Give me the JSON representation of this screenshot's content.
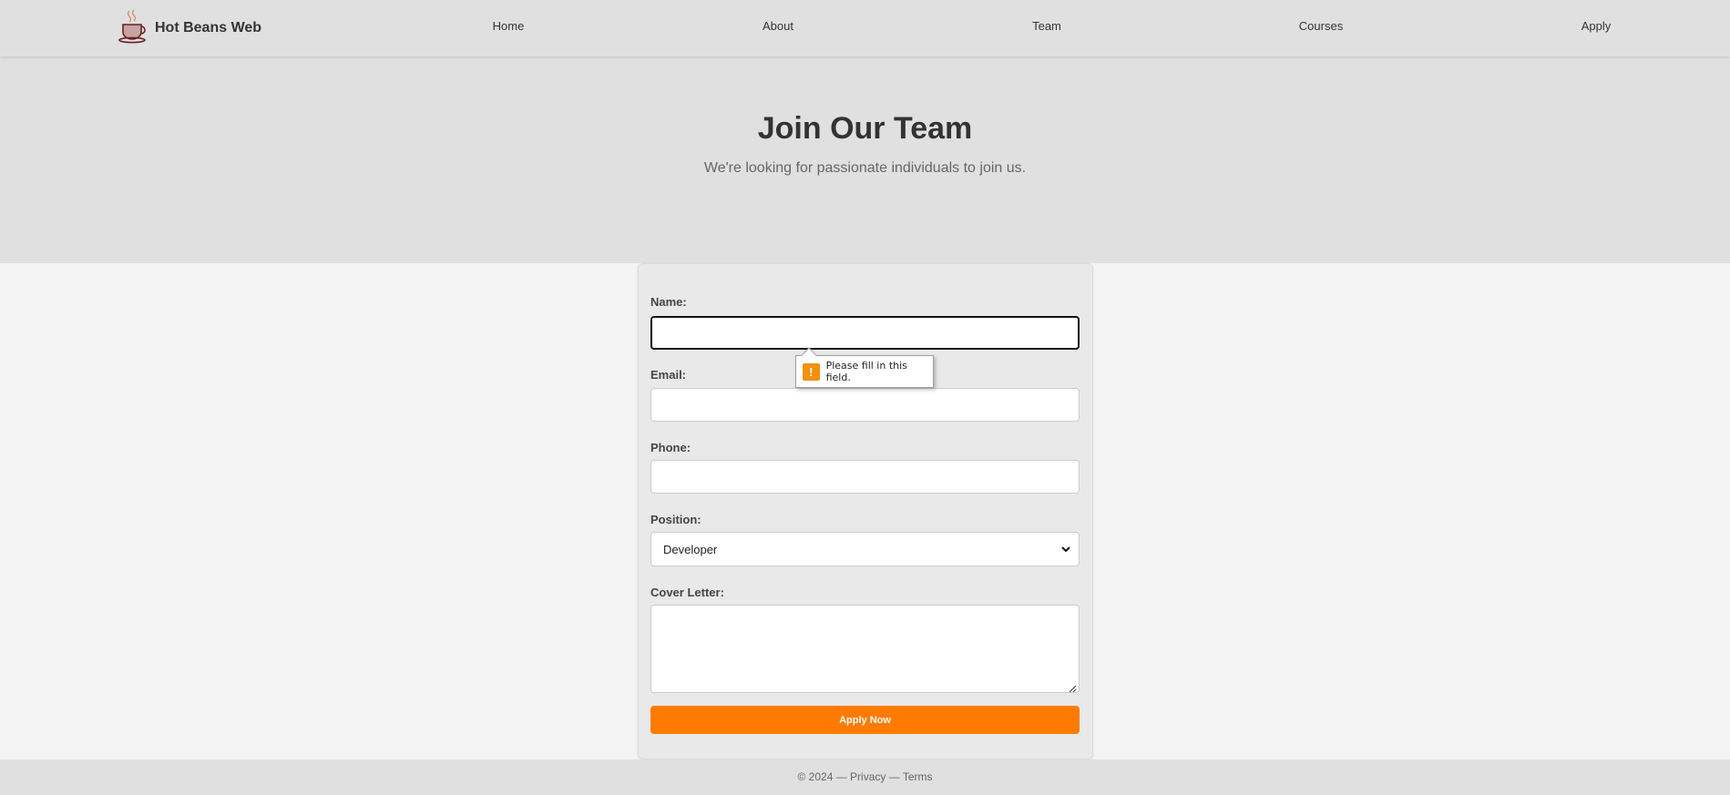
{
  "brand": {
    "name": "Hot Beans Web",
    "logo_icon": "coffee-cup-icon"
  },
  "nav": {
    "items": [
      "Home",
      "About",
      "Team",
      "Courses",
      "Apply"
    ]
  },
  "hero": {
    "title": "Join Our Team",
    "subtitle": "We're looking for passionate individuals to join us."
  },
  "form": {
    "name_label": "Name:",
    "name_value": "",
    "email_label": "Email:",
    "email_value": "",
    "phone_label": "Phone:",
    "phone_value": "",
    "position_label": "Position:",
    "position_selected": "Developer",
    "cover_label": "Cover Letter:",
    "cover_value": "",
    "submit_label": "Apply Now"
  },
  "validation": {
    "message": "Please fill in this field.",
    "icon": "warning-icon"
  },
  "footer": {
    "text": "© 2024 — Privacy — Terms"
  },
  "colors": {
    "header_bg": "#e0e0e0",
    "page_bg": "#f4f4f4",
    "accent": "#ff7b00",
    "warning": "#f2900e"
  }
}
